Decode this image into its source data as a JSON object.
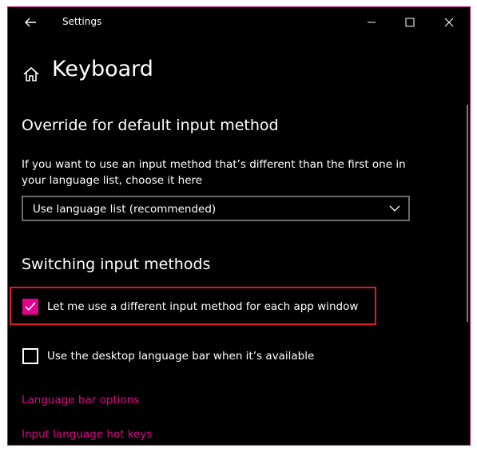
{
  "window": {
    "title": "Settings",
    "accent_color": "#e3008c",
    "highlight_color": "#e01b24",
    "border_color": "#c0147f"
  },
  "titlebar": {
    "back_icon": "back-arrow-icon",
    "minimize_icon": "minimize-icon",
    "maximize_icon": "maximize-icon",
    "close_icon": "close-icon"
  },
  "page": {
    "home_icon": "home-icon",
    "title": "Keyboard"
  },
  "override_section": {
    "title": "Override for default input method",
    "description": "If you want to use an input method that’s different than the first one in your language list, choose it here",
    "dropdown": {
      "selected": "Use language list (recommended)",
      "icon": "chevron-down-icon"
    }
  },
  "switching_section": {
    "title": "Switching input methods",
    "checkbox_per_app": {
      "label": "Let me use a different input method for each app window",
      "checked": true
    },
    "checkbox_language_bar": {
      "label": "Use the desktop language bar when it’s available",
      "checked": false
    }
  },
  "links": {
    "language_bar_options": "Language bar options",
    "input_language_hot_keys": "Input language hot keys"
  }
}
